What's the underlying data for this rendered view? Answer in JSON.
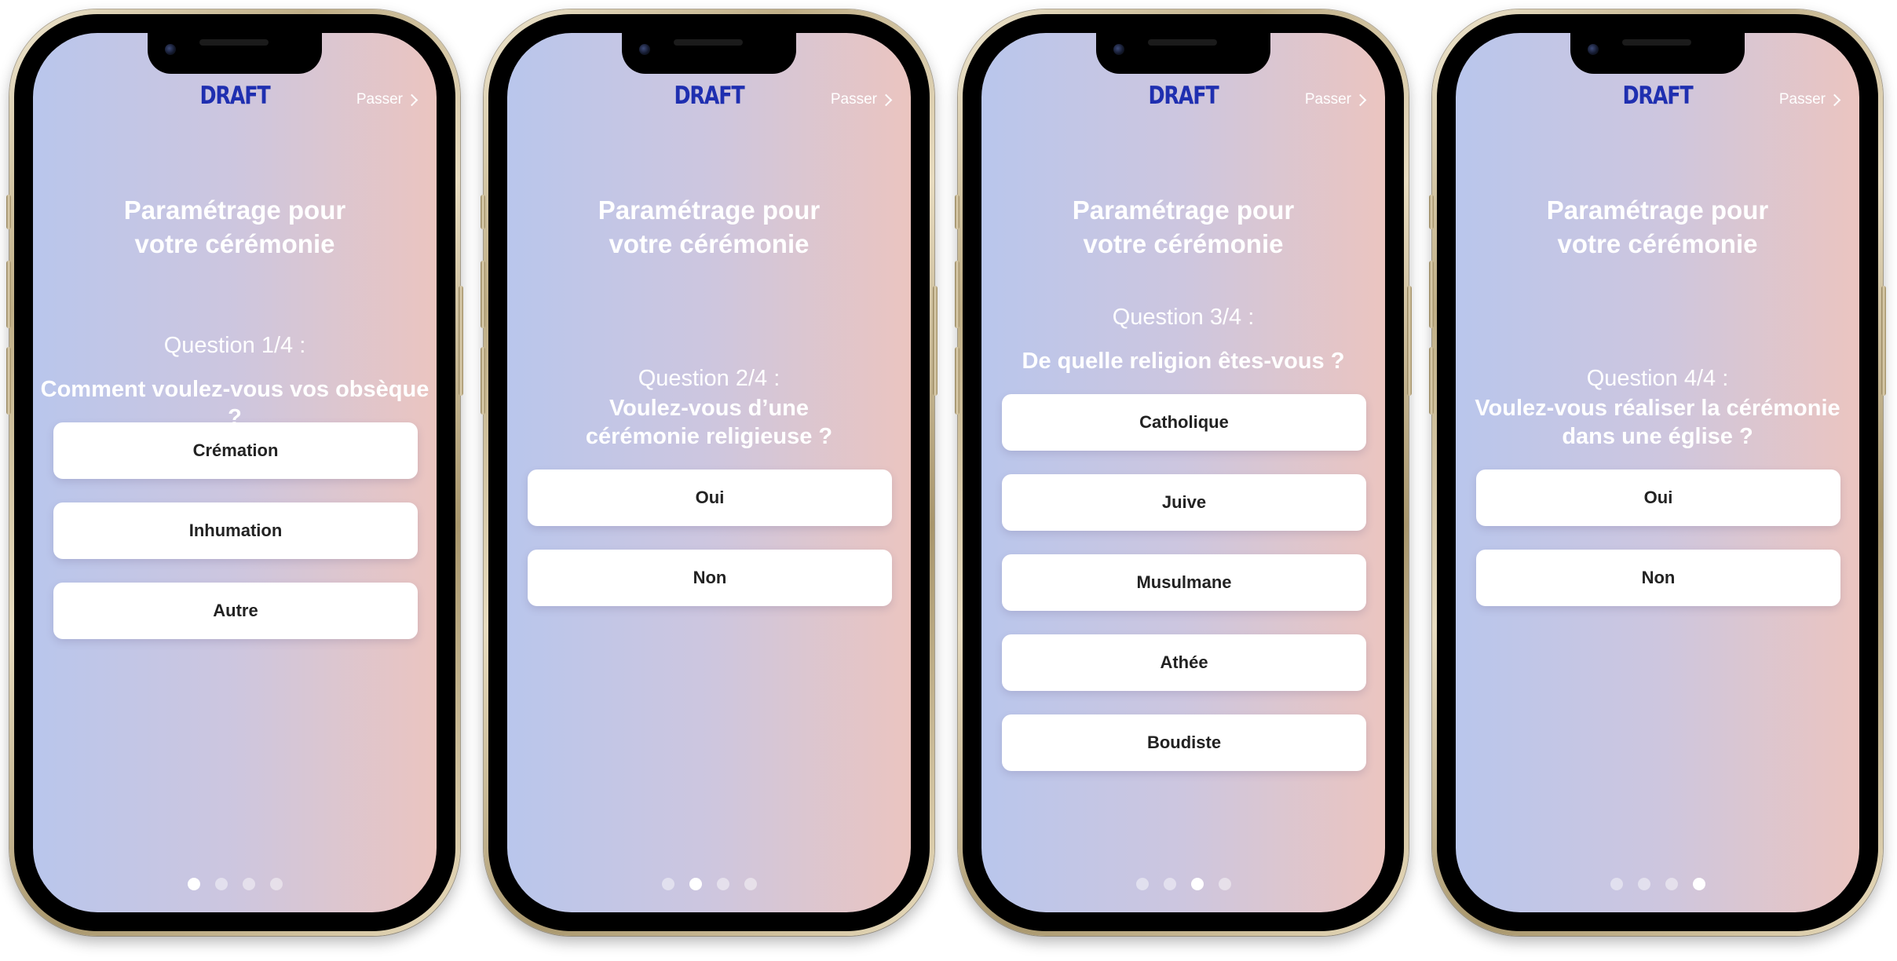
{
  "app": {
    "logo": "DRAFT",
    "skip_label": "Passer",
    "title_line1": "Paramétrage pour",
    "title_line2": "votre cérémonie"
  },
  "screens": [
    {
      "question_number": "Question 1/4 :",
      "question_text": "Comment voulez-vous vos obsèque ?",
      "options": [
        "Crémation",
        "Inhumation",
        "Autre"
      ],
      "active_page": 1
    },
    {
      "question_number": "Question 2/4 :",
      "question_text_line1": "Voulez-vous d’une",
      "question_text_line2": "cérémonie religieuse ?",
      "options": [
        "Oui",
        "Non"
      ],
      "active_page": 2
    },
    {
      "question_number": "Question 3/4 :",
      "question_text": "De quelle religion êtes-vous ?",
      "options": [
        "Catholique",
        "Juive",
        "Musulmane",
        "Athée",
        "Boudiste"
      ],
      "active_page": 3
    },
    {
      "question_number": "Question 4/4 :",
      "question_text_line1": "Voulez-vous réaliser la cérémonie",
      "question_text_line2": "dans une église ?",
      "options": [
        "Oui",
        "Non"
      ],
      "active_page": 4
    }
  ],
  "colors": {
    "brand": "#1f2fb0",
    "gradient_left": "#b9c6ec",
    "gradient_right": "#ebc5c0",
    "option_background": "#ffffff",
    "option_text": "#222222"
  },
  "icons": {
    "skip": "chevron-right-icon",
    "camera": "front-camera-icon"
  }
}
